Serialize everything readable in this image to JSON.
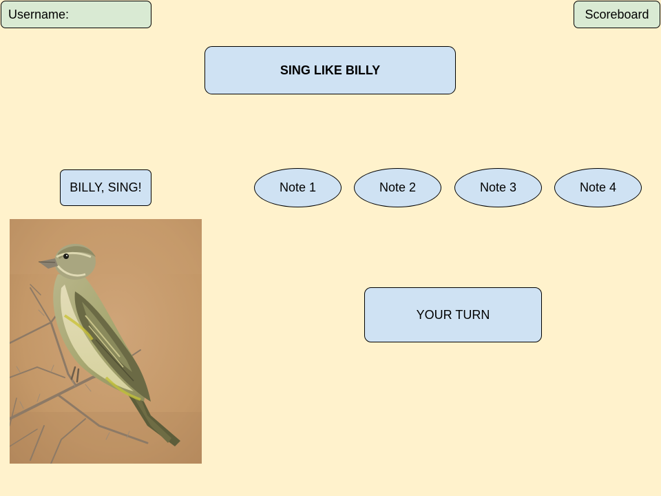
{
  "header": {
    "username_label": "Username:",
    "scoreboard_label": "Scoreboard"
  },
  "title": "SING LIKE BILLY",
  "controls": {
    "sing_button_label": "BILLY, SING!",
    "notes": [
      {
        "label": "Note 1"
      },
      {
        "label": "Note 2"
      },
      {
        "label": "Note 3"
      },
      {
        "label": "Note 4"
      }
    ],
    "your_turn_label": "YOUR TURN"
  },
  "colors": {
    "background": "#fff2cc",
    "green_box": "#d9ead3",
    "blue_box": "#cfe2f3"
  },
  "image": {
    "subject": "bird-on-branch"
  }
}
